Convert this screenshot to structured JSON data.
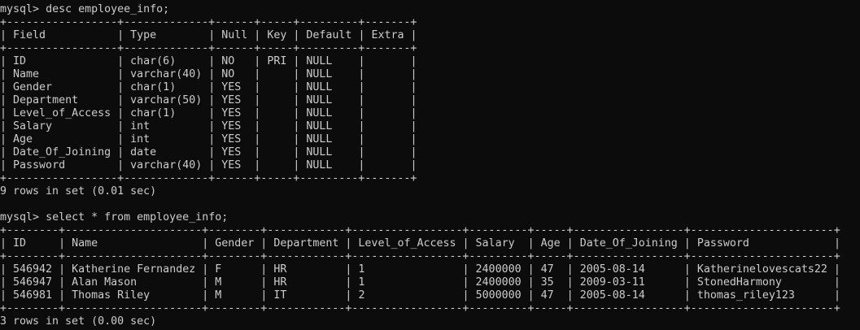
{
  "terminal": {
    "prompt": "mysql>",
    "commands": [
      {
        "text": "desc employee_info;"
      },
      {
        "text": "select * from employee_info;"
      }
    ],
    "result_lines": [
      "9 rows in set (0.01 sec)",
      "3 rows in set (0.00 sec)"
    ]
  },
  "desc_table": {
    "columns": [
      "Field",
      "Type",
      "Null",
      "Key",
      "Default",
      "Extra"
    ],
    "rows": [
      [
        "ID",
        "char(6)",
        "NO",
        "PRI",
        "NULL",
        ""
      ],
      [
        "Name",
        "varchar(40)",
        "NO",
        "",
        "NULL",
        ""
      ],
      [
        "Gender",
        "char(1)",
        "YES",
        "",
        "NULL",
        ""
      ],
      [
        "Department",
        "varchar(50)",
        "YES",
        "",
        "NULL",
        ""
      ],
      [
        "Level_of_Access",
        "char(1)",
        "YES",
        "",
        "NULL",
        ""
      ],
      [
        "Salary",
        "int",
        "YES",
        "",
        "NULL",
        ""
      ],
      [
        "Age",
        "int",
        "YES",
        "",
        "NULL",
        ""
      ],
      [
        "Date_Of_Joining",
        "date",
        "YES",
        "",
        "NULL",
        ""
      ],
      [
        "Password",
        "varchar(40)",
        "YES",
        "",
        "NULL",
        ""
      ]
    ]
  },
  "select_table": {
    "columns": [
      "ID",
      "Name",
      "Gender",
      "Department",
      "Level_of_Access",
      "Salary",
      "Age",
      "Date_Of_Joining",
      "Password"
    ],
    "rows": [
      [
        "546942",
        "Katherine Fernandez",
        "F",
        "HR",
        "1",
        "2400000",
        "47",
        "2005-08-14",
        "Katherinelovescats22"
      ],
      [
        "546947",
        "Alan Mason",
        "M",
        "HR",
        "1",
        "2400000",
        "35",
        "2009-03-11",
        "StonedHarmony"
      ],
      [
        "546981",
        "Thomas Riley",
        "M",
        "IT",
        "2",
        "5000000",
        "47",
        "2005-08-14",
        "thomas_riley123"
      ]
    ]
  }
}
